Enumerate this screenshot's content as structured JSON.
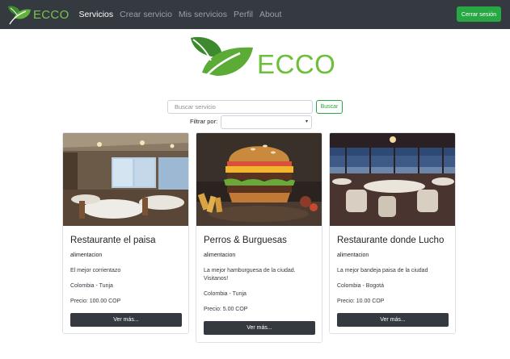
{
  "navbar": {
    "brand": "ECCO",
    "links": [
      "Servicios",
      "Crear servicio",
      "Mis servicios",
      "Perfil",
      "About"
    ],
    "active_index": 0,
    "logout_label": "Cerrar sesión"
  },
  "hero": {
    "logo_text": "ECCO"
  },
  "search": {
    "placeholder": "Buscar servicio",
    "button_label": "Buscar"
  },
  "filter": {
    "label": "Filtrar por:",
    "selected": ""
  },
  "colors": {
    "navbar": "#343a40",
    "accent_green": "#28a745",
    "logo_green": "#6cbf3b",
    "card_button": "#343a40"
  },
  "cards": [
    {
      "title": "Restaurante el paisa",
      "category": "alimentacion",
      "description": "El mejor corrientazo",
      "location": "Colombia - Tunja",
      "price": "Precio: 100.00 COP",
      "button": "Ver más..."
    },
    {
      "title": "Perros & Burguesas",
      "category": "alimentacion",
      "description": "La mejor hamburguesa de la ciudad. Visitanos!",
      "location": "Colombia - Tunja",
      "price": "Precio: 5.00 COP",
      "button": "Ver más..."
    },
    {
      "title": "Restaurante donde Lucho",
      "category": "alimentacion",
      "description": "La mejor bandeja paisa de la ciudad",
      "location": "Colombia - Bogotá",
      "price": "Precio: 10.00 COP",
      "button": "Ver más..."
    }
  ]
}
